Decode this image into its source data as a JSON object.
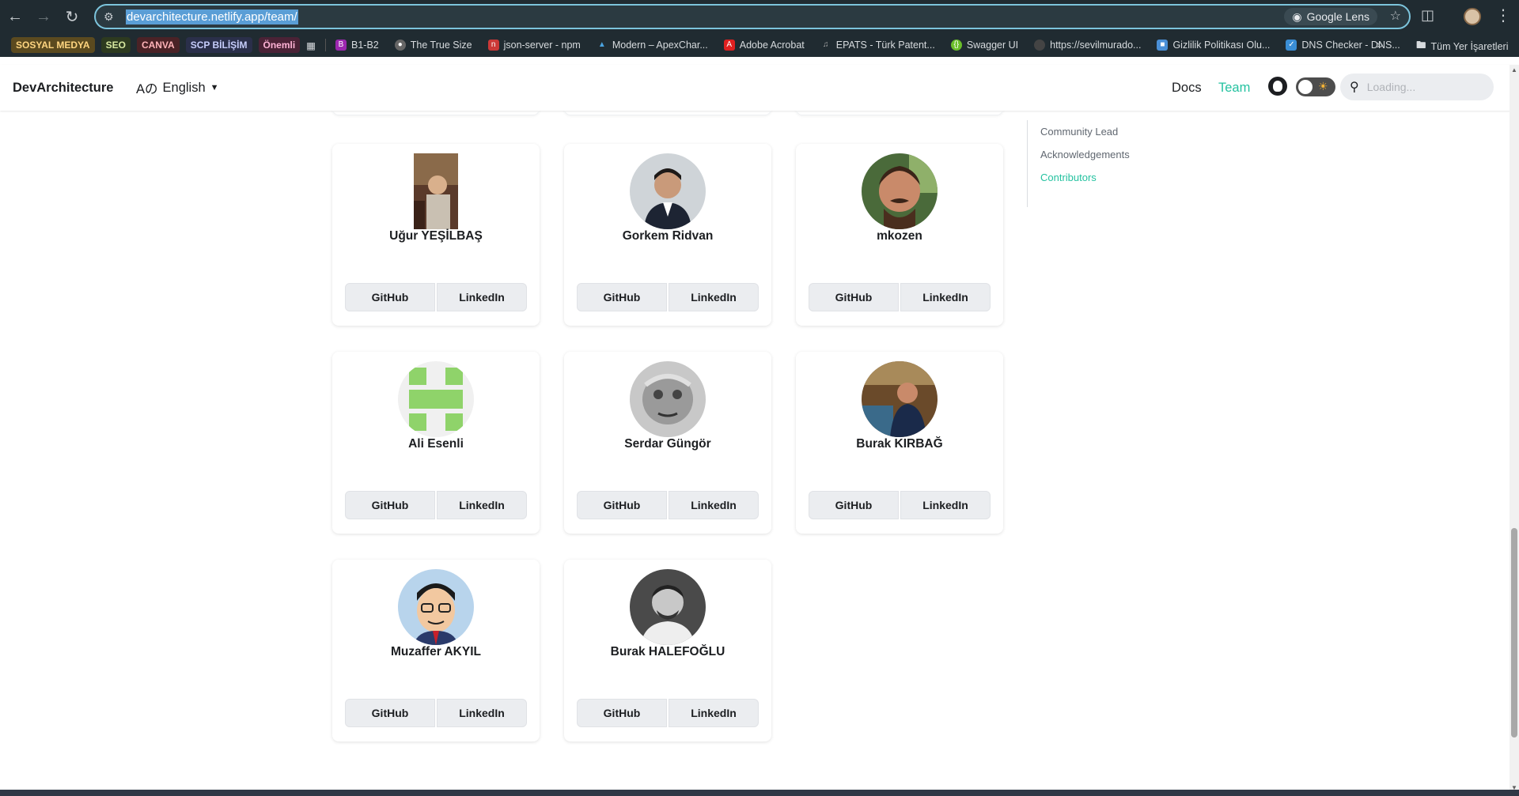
{
  "browser": {
    "url": "devarchitecture.netlify.app/team/",
    "lens_label": "Google Lens",
    "bookmarks_tags": [
      {
        "label": "SOSYAL MEDYA",
        "bg": "#5b4a1f",
        "fg": "#ffd580"
      },
      {
        "label": "SEO",
        "bg": "#2d3a1f",
        "fg": "#d7e8a0"
      },
      {
        "label": "CANVA",
        "bg": "#4a2226",
        "fg": "#ffb3b8"
      },
      {
        "label": "SCP BİLİŞİM",
        "bg": "#2a2f4a",
        "fg": "#c6cdfb"
      },
      {
        "label": "Önemli",
        "bg": "#4a2236",
        "fg": "#ffb3d6"
      }
    ],
    "bookmarks": [
      {
        "label": "B1-B2",
        "icon": "bookmark-b-icon",
        "color": "#9c27b0"
      },
      {
        "label": "The True Size",
        "icon": "globe-icon",
        "color": "#666666"
      },
      {
        "label": "json-server - npm",
        "icon": "npm-icon",
        "color": "#cb3837"
      },
      {
        "label": "Modern – ApexChar...",
        "icon": "apex-icon",
        "color": "#4aa3df"
      },
      {
        "label": "Adobe Acrobat",
        "icon": "acrobat-icon",
        "color": "#e02020"
      },
      {
        "label": "EPATS - Türk Patent...",
        "icon": "epats-icon",
        "color": "#333333"
      },
      {
        "label": "Swagger UI",
        "icon": "swagger-icon",
        "color": "#6abf29"
      },
      {
        "label": "https://sevilmurado...",
        "icon": "link-icon",
        "color": "#444444"
      },
      {
        "label": "Gizlilik Politikası Olu...",
        "icon": "doc-icon",
        "color": "#4a8fd6"
      },
      {
        "label": "DNS Checker - DNS...",
        "icon": "shield-icon",
        "color": "#3a8ed6"
      }
    ],
    "all_bookmarks": "Tüm Yer İşaretleri"
  },
  "navbar": {
    "brand": "DevArchitecture",
    "language": "English",
    "docs": "Docs",
    "team": "Team",
    "search_placeholder": "Loading..."
  },
  "toc": {
    "items": [
      "Community Lead",
      "Acknowledgements",
      "Contributors"
    ],
    "active": "Contributors"
  },
  "contributors": [
    {
      "name": "Uğur YEŞİLBAŞ",
      "github": "GitHub",
      "linkedin": "LinkedIn"
    },
    {
      "name": "Gorkem Ridvan",
      "github": "GitHub",
      "linkedin": "LinkedIn"
    },
    {
      "name": "mkozen",
      "github": "GitHub",
      "linkedin": "LinkedIn"
    },
    {
      "name": "Ali Esenli",
      "github": "GitHub",
      "linkedin": "LinkedIn"
    },
    {
      "name": "Serdar Güngör",
      "github": "GitHub",
      "linkedin": "LinkedIn"
    },
    {
      "name": "Burak KIRBAĞ",
      "github": "GitHub",
      "linkedin": "LinkedIn"
    },
    {
      "name": "Muzaffer AKYIL",
      "github": "GitHub",
      "linkedin": "LinkedIn"
    },
    {
      "name": "Burak HALEFOĞLU",
      "github": "GitHub",
      "linkedin": "LinkedIn"
    }
  ],
  "colors": {
    "accent": "#25c2a0",
    "chrome_bg": "#202b31"
  }
}
